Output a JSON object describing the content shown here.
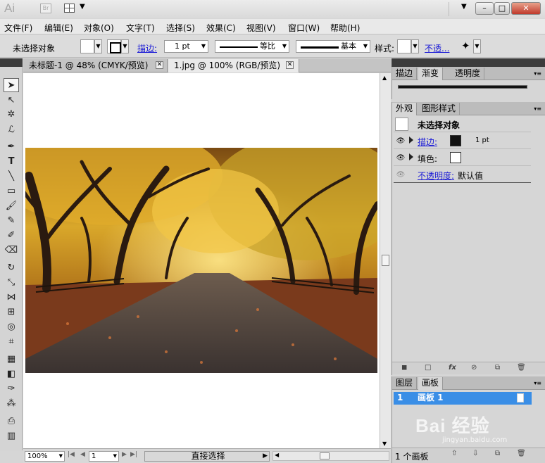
{
  "titlebar": {
    "logo": "Ai",
    "bridge": "Br",
    "min_label": "–",
    "max_label": "□",
    "close_label": "✕"
  },
  "menubar": {
    "items": [
      "文件(F)",
      "编辑(E)",
      "对象(O)",
      "文字(T)",
      "选择(S)",
      "效果(C)",
      "视图(V)",
      "窗口(W)",
      "帮助(H)"
    ]
  },
  "controlbar": {
    "selection_status": "未选择对象",
    "stroke_label": "描边:",
    "stroke_weight": "1 pt",
    "profile_label": "等比",
    "brush_label": "基本",
    "style_label": "样式:",
    "opacity_label": "不透..."
  },
  "doc_tabs": [
    {
      "label": "未标题-1 @ 48% (CMYK/预览)"
    },
    {
      "label": "1.jpg @ 100% (RGB/预览)"
    }
  ],
  "gradient_panel": {
    "tabs": [
      "描边",
      "渐变",
      "透明度"
    ]
  },
  "appearance_panel": {
    "tabs": [
      "外观",
      "图形样式"
    ],
    "header": "未选择对象",
    "stroke_label": "描边:",
    "stroke_value": "1 pt",
    "fill_label": "填色:",
    "opacity_label": "不透明度:",
    "opacity_value": "默认值"
  },
  "artboards_panel": {
    "tabs": [
      "图层",
      "画板"
    ],
    "rows": [
      {
        "index": "1",
        "name": "画板 1"
      }
    ],
    "footer_count": "1 个画板"
  },
  "statusbar": {
    "zoom": "100%",
    "page": "1",
    "tool": "直接选择"
  },
  "watermark": {
    "text": "Bai 经验",
    "sub": "jingyan.baidu.com"
  },
  "colors": {
    "accent": "#3a8ee6",
    "link": "#1a1ad6",
    "panel": "#d6d6d6"
  }
}
